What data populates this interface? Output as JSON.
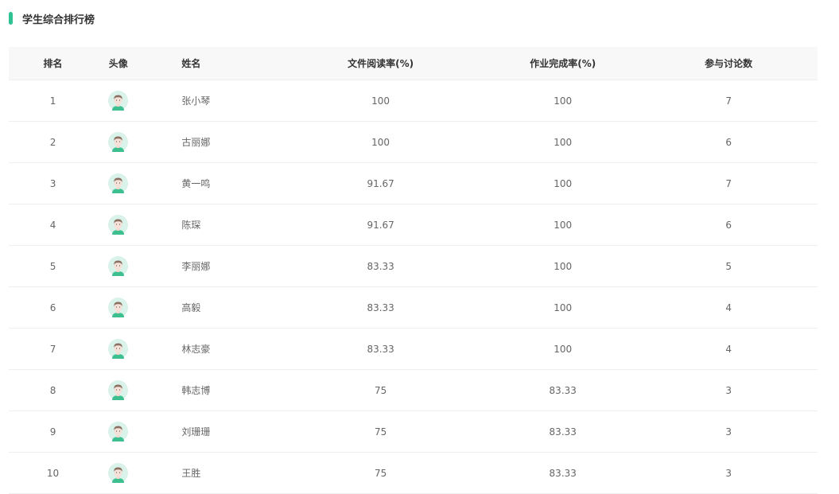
{
  "title": "学生综合排行榜",
  "headers": [
    "排名",
    "头像",
    "姓名",
    "文件阅读率(%)",
    "作业完成率(%)",
    "参与讨论数"
  ],
  "rows": [
    [
      "1",
      "张小琴",
      "100",
      "100",
      "7"
    ],
    [
      "2",
      "古丽娜",
      "100",
      "100",
      "6"
    ],
    [
      "3",
      "黄一鸣",
      "91.67",
      "100",
      "7"
    ],
    [
      "4",
      "陈琛",
      "91.67",
      "100",
      "6"
    ],
    [
      "5",
      "李丽娜",
      "83.33",
      "100",
      "5"
    ],
    [
      "6",
      "高毅",
      "83.33",
      "100",
      "4"
    ],
    [
      "7",
      "林志豪",
      "83.33",
      "100",
      "4"
    ],
    [
      "8",
      "韩志博",
      "75",
      "83.33",
      "3"
    ],
    [
      "9",
      "刘珊珊",
      "75",
      "83.33",
      "3"
    ],
    [
      "10",
      "王胜",
      "75",
      "83.33",
      "3"
    ]
  ],
  "accent": "#2fc393"
}
